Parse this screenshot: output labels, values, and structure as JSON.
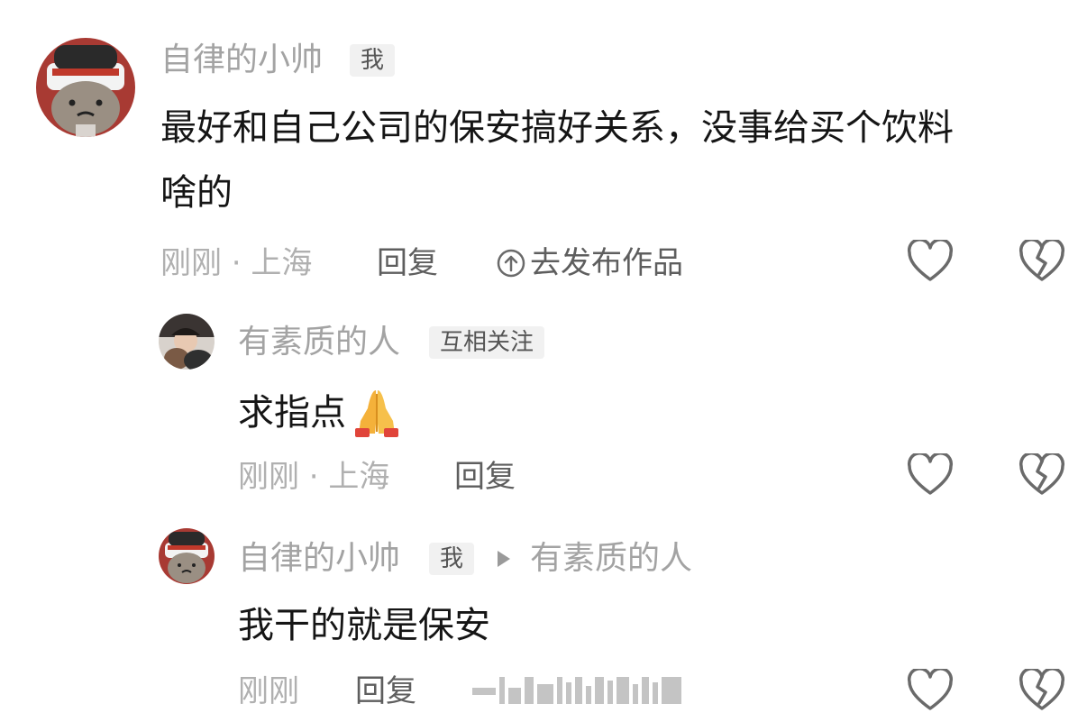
{
  "comments": [
    {
      "author": "自律的小帅",
      "badge": "我",
      "text_line1": "最好和自己公司的保安搞好关系，没事给买个饮料",
      "text_line2": "啥的",
      "time_location": "刚刚 · 上海",
      "reply_label": "回复",
      "publish_label": "去发布作品"
    },
    {
      "author": "有素质的人",
      "badge": "互相关注",
      "text": "求指点",
      "emoji": "folded-hands",
      "time_location": "刚刚 · 上海",
      "reply_label": "回复"
    },
    {
      "author": "自律的小帅",
      "badge": "我",
      "reply_to": "有素质的人",
      "text": "我干的就是保安",
      "time_location": "刚刚",
      "reply_label": "回复"
    }
  ],
  "icons": {
    "like": "heart-outline-icon",
    "dislike": "broken-heart-icon",
    "publish": "up-arrow-circle-icon"
  },
  "colors": {
    "text_primary": "#151515",
    "text_muted": "#a3a3a3",
    "icon_stroke": "#6a6a6a"
  }
}
